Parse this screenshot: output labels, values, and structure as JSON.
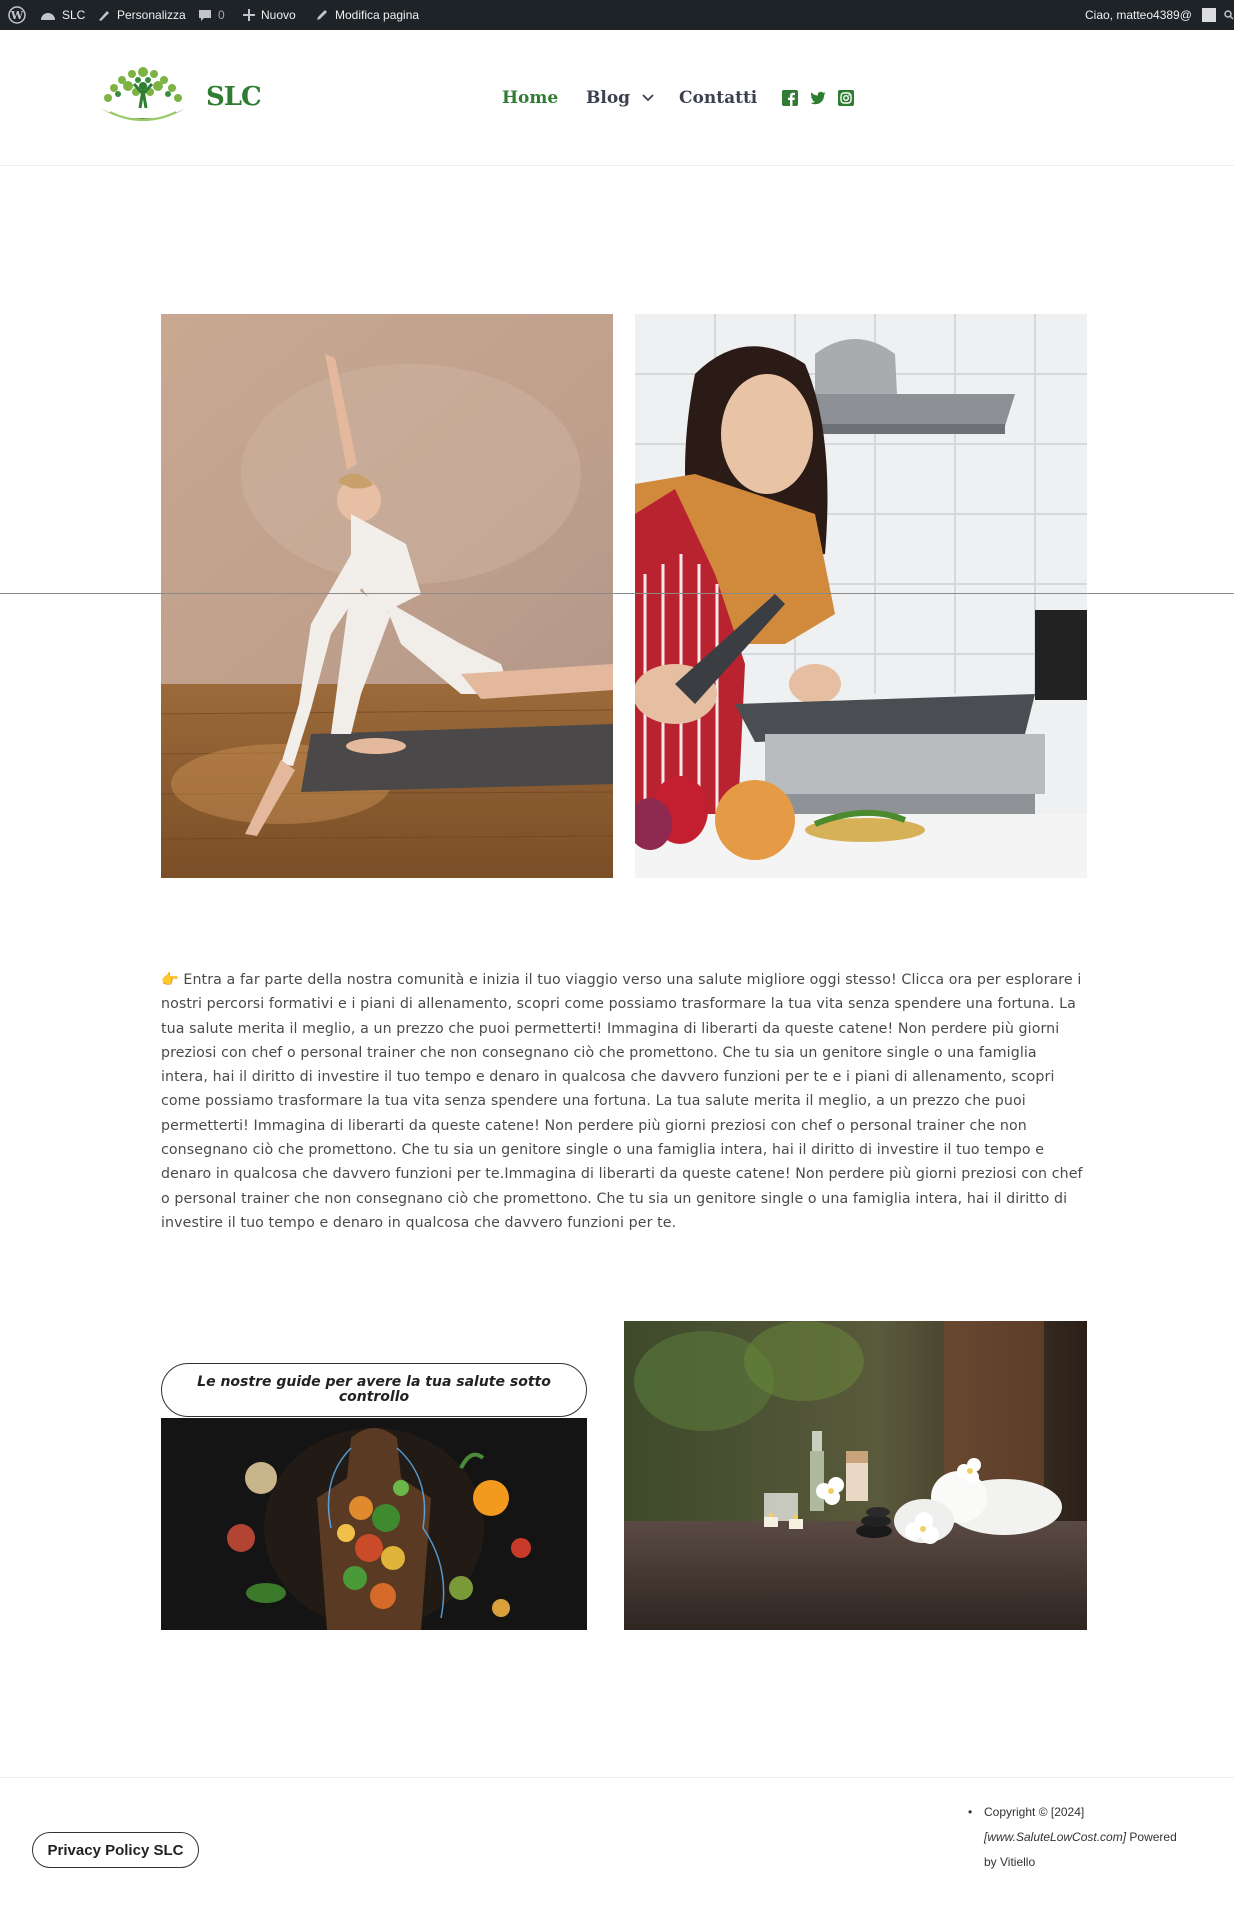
{
  "adminbar": {
    "site": "SLC",
    "customize": "Personalizza",
    "comments": "0",
    "new": "Nuovo",
    "edit": "Modifica pagina",
    "greeting": "Ciao, matteo4389@"
  },
  "header": {
    "site_title": "SLC",
    "nav": {
      "home": "Home",
      "blog": "Blog",
      "contacts": "Contatti"
    },
    "social_icons": [
      "facebook-icon",
      "twitter-icon",
      "instagram-icon"
    ],
    "accent_color": "#2e7d32"
  },
  "content": {
    "intro_emoji": "👉",
    "paragraph": "Entra a far parte della nostra comunità e inizia il tuo viaggio verso una salute migliore oggi stesso! Clicca ora per esplorare i nostri percorsi formativi e i piani di allenamento, scopri come possiamo trasformare la tua vita senza spendere una fortuna. La tua salute merita il meglio, a un prezzo che puoi permetterti! Immagina di liberarti da queste catene! Non perdere più giorni preziosi con chef o personal trainer che non consegnano ciò che promettono. Che tu sia un genitore single o una famiglia intera, hai il diritto di investire il tuo tempo e denaro in qualcosa che davvero funzioni per te e i piani di allenamento, scopri come possiamo trasformare la tua vita senza spendere una fortuna. La tua salute merita il meglio, a un prezzo che puoi permetterti! Immagina di liberarti da queste catene! Non perdere più giorni preziosi con chef o personal trainer che non consegnano ciò che promettono. Che tu sia un genitore single o una famiglia intera, hai il diritto di investire il tuo tempo e denaro in qualcosa che davvero funzioni per te.Immagina di liberarti da queste catene! Non perdere più giorni preziosi con chef o personal trainer che non consegnano ciò che promettono. Che tu sia un genitore single o una famiglia intera, hai il diritto di investire il tuo tempo e denaro in qualcosa che davvero funzioni per te.",
    "guides_button": "Le nostre guide per avere la tua salute sotto controllo"
  },
  "footer": {
    "privacy_button": "Privacy Policy SLC",
    "copyright_line1": "Copyright © [2024]",
    "copyright_line2_italic": "[www.SaluteLowCost.com]",
    "copyright_line2_rest": " Powered",
    "copyright_line3": "by Vitiello"
  }
}
